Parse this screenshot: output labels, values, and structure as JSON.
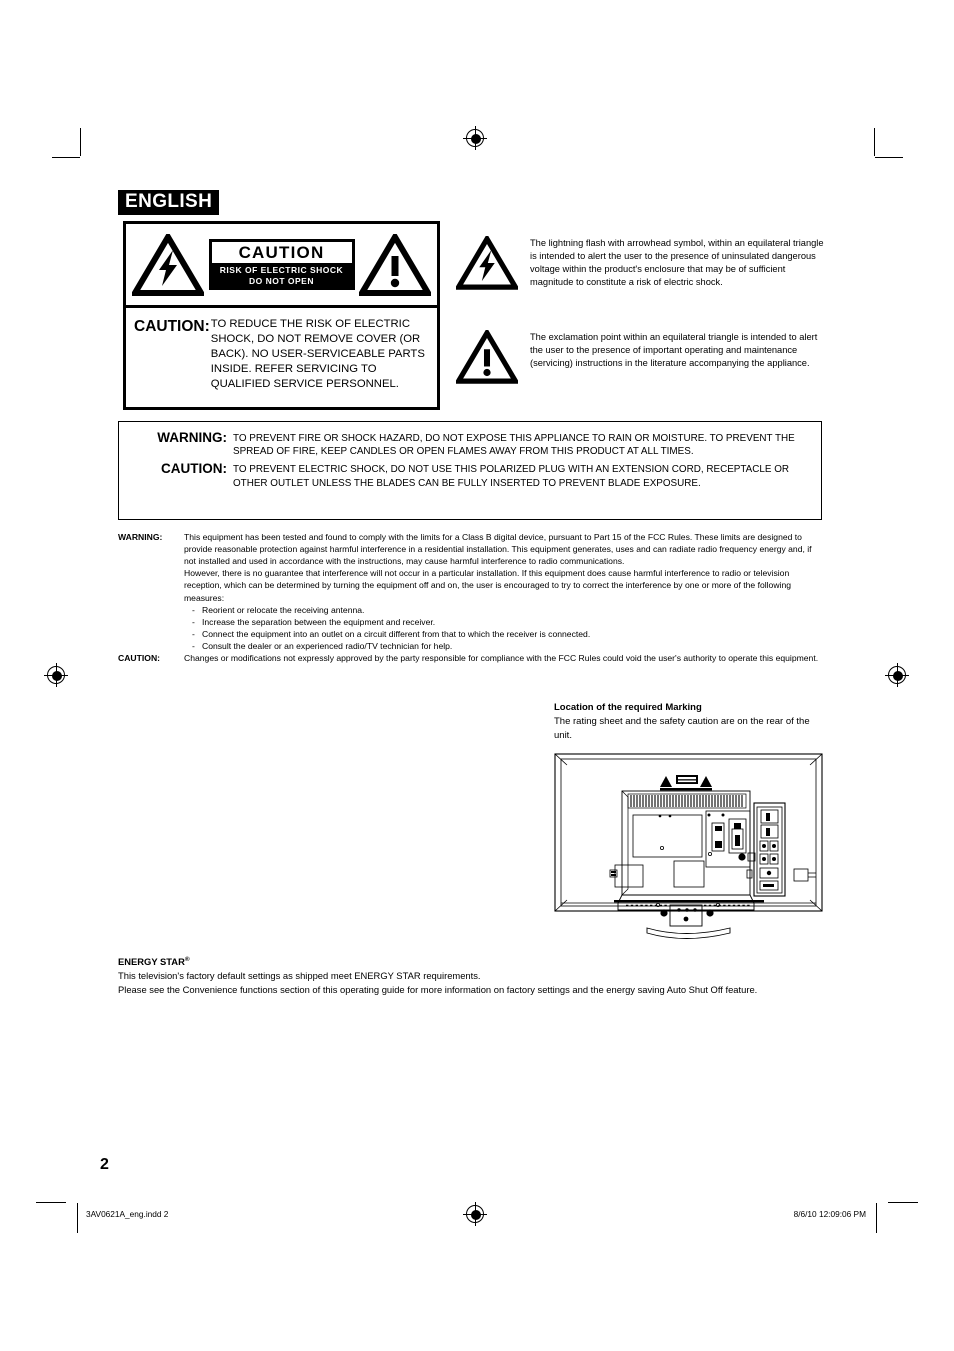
{
  "language_badge": "ENGLISH",
  "caution_box": {
    "plate_title": "CAUTION",
    "plate_line1": "RISK OF ELECTRIC SHOCK",
    "plate_line2": "DO NOT OPEN",
    "left_icon": "lightning-bolt-triangle-icon",
    "right_icon": "exclamation-triangle-icon",
    "label": "CAUTION:",
    "body": "TO REDUCE THE RISK OF ELECTRIC SHOCK, DO NOT REMOVE COVER (OR BACK). NO USER-SERVICEABLE PARTS INSIDE. REFER SERVICING TO QUALIFIED SERVICE PERSONNEL."
  },
  "symbols": [
    {
      "icon": "lightning-bolt-triangle-icon",
      "text": "The lightning flash with arrowhead symbol, within an equilateral triangle is intended to alert the user to the presence of uninsulated dangerous voltage within the product's enclosure that may be of sufficient magnitude to constitute a risk of electric shock."
    },
    {
      "icon": "exclamation-triangle-icon",
      "text": "The exclamation point within an equilateral triangle is intended to alert the user to the presence of important operating and maintenance (servicing) instructions in the literature accompanying the appliance."
    }
  ],
  "warning_caution_box": {
    "warning_label": "WARNING:",
    "warning_text": "TO PREVENT FIRE OR SHOCK HAZARD, DO NOT EXPOSE THIS APPLIANCE TO RAIN OR MOISTURE. TO PREVENT THE SPREAD OF FIRE, KEEP CANDLES OR OPEN FLAMES AWAY FROM THIS PRODUCT AT ALL TIMES.",
    "caution_label": "CAUTION:",
    "caution_text": "TO PREVENT ELECTRIC SHOCK, DO NOT USE THIS POLARIZED PLUG WITH AN EXTENSION CORD, RECEPTACLE OR OTHER OUTLET UNLESS THE BLADES CAN BE FULLY INSERTED TO PREVENT BLADE EXPOSURE."
  },
  "fcc": {
    "warning_label": "WARNING:",
    "warning_para1": "This equipment has been tested and found to comply with the limits for a Class B digital device, pursuant to Part 15 of the FCC Rules. These limits are designed to provide reasonable protection against harmful interference in a residential installation. This equipment generates, uses and can radiate radio frequency energy and, if not installed and used in accordance with the instructions, may cause harmful interference to radio communications.",
    "warning_para2": "However, there is no guarantee that interference will not occur in a particular installation. If this equipment does cause harmful interference to radio or television reception, which can be determined by turning the equipment off and on, the user is encouraged to try to correct the interference by one or more of the following measures:",
    "bullets": [
      "Reorient or relocate the receiving antenna.",
      "Increase the separation between the equipment and receiver.",
      "Connect the equipment into an outlet on a circuit different from that to which the receiver is connected.",
      "Consult the dealer or an experienced radio/TV technician for help."
    ],
    "bullet_dash": "-",
    "caution_label": "CAUTION:",
    "caution_text": "Changes or modifications not expressly approved by the party responsible for compliance with the FCC Rules could void the user's authority to operate this equipment."
  },
  "marking": {
    "title": "Location of the required Marking",
    "text": "The rating sheet and the safety caution are on the rear of the unit.",
    "figure_name": "tv-rear-view-illustration"
  },
  "energy_star": {
    "title": "ENERGY STAR",
    "title_mark": "®",
    "line1": "This television's factory default settings as shipped meet ENERGY STAR requirements.",
    "line2": "Please see the Convenience functions section of this operating guide for more information on factory settings and the energy saving Auto Shut Off feature."
  },
  "page_number": "2",
  "footer": {
    "file": "3AV0621A_eng.indd   2",
    "date": "8/6/10   12:09:06 PM"
  },
  "colors": {
    "ink": "#000000",
    "paper": "#ffffff"
  }
}
